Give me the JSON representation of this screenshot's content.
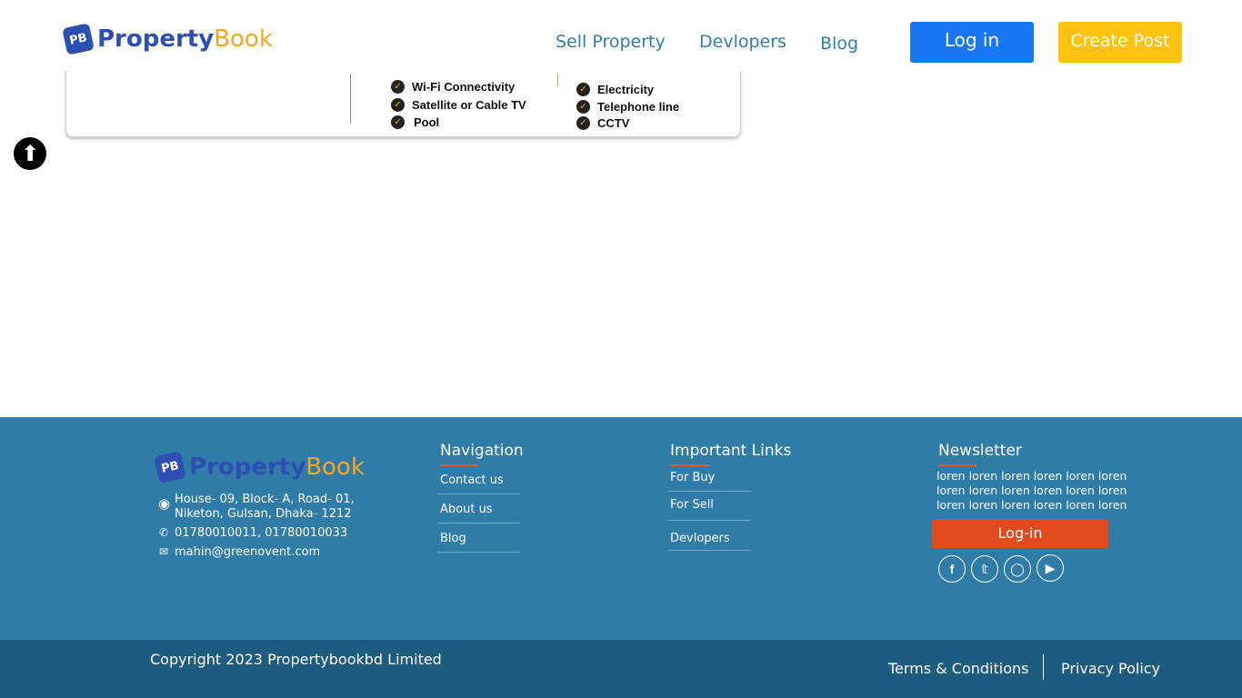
{
  "header": {
    "logo": {
      "mark": "PB",
      "word1": "Property",
      "word2": "Book"
    },
    "nav": [
      "Sell Property",
      "Devlopers",
      "Blog"
    ],
    "login_label": "Log in",
    "create_post_label": "Create Post"
  },
  "amenities": {
    "left": [
      "Wi-Fi Connectivity",
      "Satellite or Cable TV",
      "Pool"
    ],
    "right": [
      "Electricity",
      "Telephone line",
      "CCTV"
    ]
  },
  "footer": {
    "logo": {
      "mark": "PB",
      "word1": "Property",
      "word2": "Book"
    },
    "address": "House- 09, Block- A, Road- 01, Niketon, Gulsan, Dhaka- 1212",
    "address_line1": "House- 09, Block- A, Road- 01,",
    "address_line2": "Niketon, Gulsan, Dhaka- 1212",
    "phone": "01780010011, 01780010033",
    "email": "mahin@greenovent.com",
    "navigation": {
      "title": "Navigation",
      "links": [
        "Contact us",
        "About us",
        "Blog"
      ]
    },
    "important_links": {
      "title": "Important Links",
      "links": [
        "For Buy",
        "For Sell",
        "Devlopers"
      ]
    },
    "newsletter": {
      "title": "Newsletter",
      "text": "loren loren loren loren loren loren loren loren loren loren loren loren loren loren loren loren loren loren",
      "login_label": "Log-in"
    },
    "social": [
      "facebook-icon",
      "twitter-icon",
      "instagram-icon",
      "youtube-icon"
    ],
    "copyright": "Copyright 2023 Propertybookbd Limited",
    "terms": "Terms & Conditions",
    "privacy": "Privacy Policy"
  },
  "colors": {
    "brand_blue": "#2d4fb3",
    "brand_yellow": "#f5a623",
    "footer_bg": "#2f7ca8",
    "footer_bottom": "#1d5b7f",
    "login_btn": "#1877f2",
    "post_btn": "#ffc20e",
    "newsletter_btn": "#e04a1f"
  }
}
